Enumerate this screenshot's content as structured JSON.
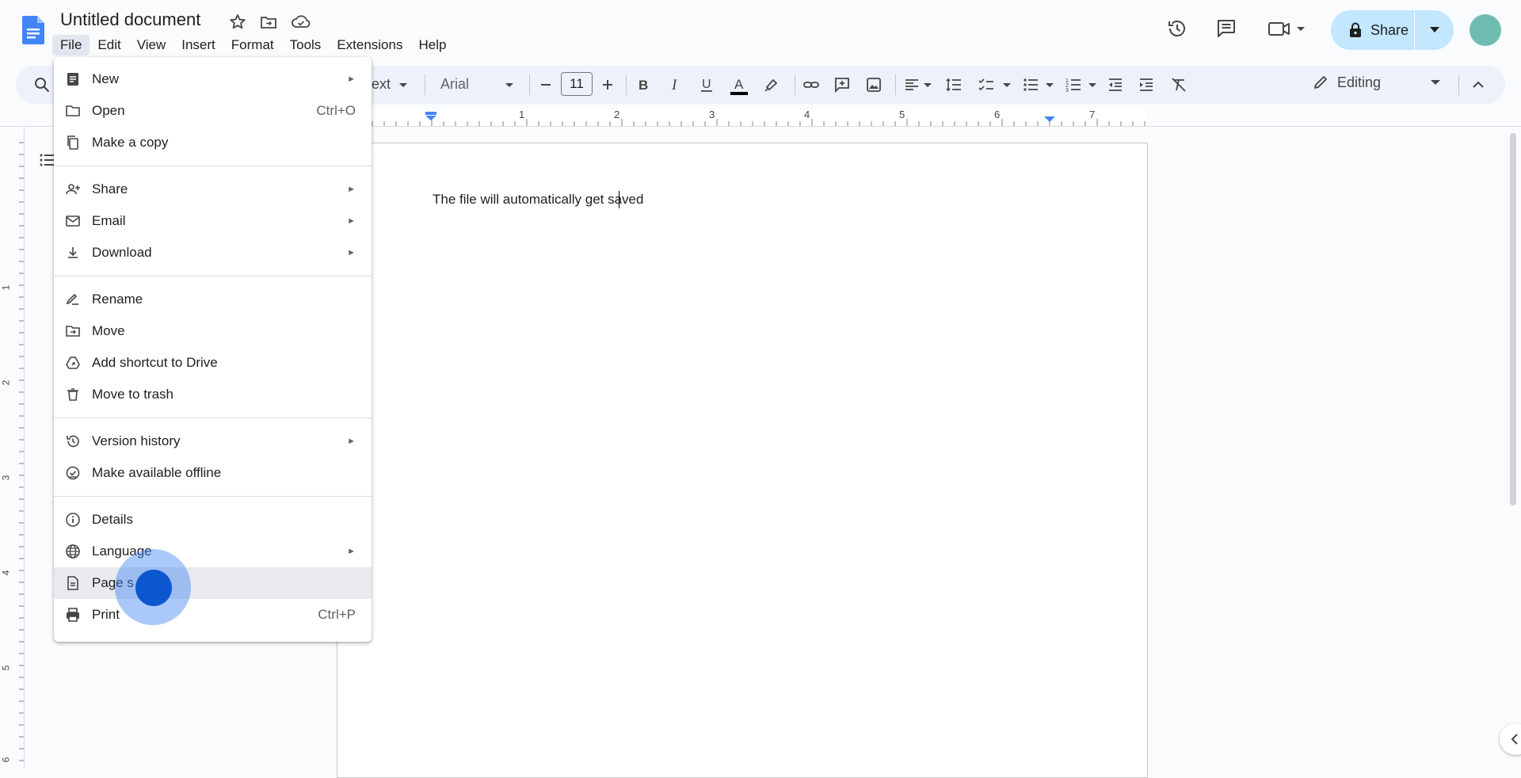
{
  "document": {
    "title": "Untitled document",
    "body_text": "The file will automatically get saved"
  },
  "menubar": [
    "File",
    "Edit",
    "View",
    "Insert",
    "Format",
    "Tools",
    "Extensions",
    "Help"
  ],
  "header": {
    "share_label": "Share"
  },
  "toolbar": {
    "style_label": "ext",
    "font_label": "Arial",
    "font_size": "11",
    "mode_label": "Editing"
  },
  "ruler": {
    "labels": [
      "1",
      "2",
      "3",
      "4",
      "5",
      "6",
      "7"
    ]
  },
  "vruler": {
    "labels": [
      "1",
      "2",
      "3",
      "4",
      "5",
      "6"
    ]
  },
  "file_menu": {
    "groups": [
      [
        {
          "label": "New",
          "icon": "doc-icon",
          "submenu": true
        },
        {
          "label": "Open",
          "icon": "folder-icon",
          "shortcut": "Ctrl+O"
        },
        {
          "label": "Make a copy",
          "icon": "copy-icon"
        }
      ],
      [
        {
          "label": "Share",
          "icon": "person-add-icon",
          "submenu": true
        },
        {
          "label": "Email",
          "icon": "mail-icon",
          "submenu": true
        },
        {
          "label": "Download",
          "icon": "download-icon",
          "submenu": true
        }
      ],
      [
        {
          "label": "Rename",
          "icon": "rename-icon"
        },
        {
          "label": "Move",
          "icon": "move-folder-icon"
        },
        {
          "label": "Add shortcut to Drive",
          "icon": "drive-shortcut-icon"
        },
        {
          "label": "Move to trash",
          "icon": "trash-icon"
        }
      ],
      [
        {
          "label": "Version history",
          "icon": "history-icon",
          "submenu": true
        },
        {
          "label": "Make available offline",
          "icon": "offline-icon"
        }
      ],
      [
        {
          "label": "Details",
          "icon": "info-icon"
        },
        {
          "label": "Language",
          "icon": "globe-icon",
          "submenu": true
        },
        {
          "label": "Page s",
          "icon": "page-icon",
          "hover": true
        },
        {
          "label": "Print",
          "icon": "print-icon",
          "shortcut": "Ctrl+P"
        }
      ]
    ]
  },
  "colors": {
    "accent": "#0b57d0",
    "share_bg": "#c2e7ff",
    "toolbar_bg": "#edf2fa",
    "avatar": "#6ebdb0"
  }
}
